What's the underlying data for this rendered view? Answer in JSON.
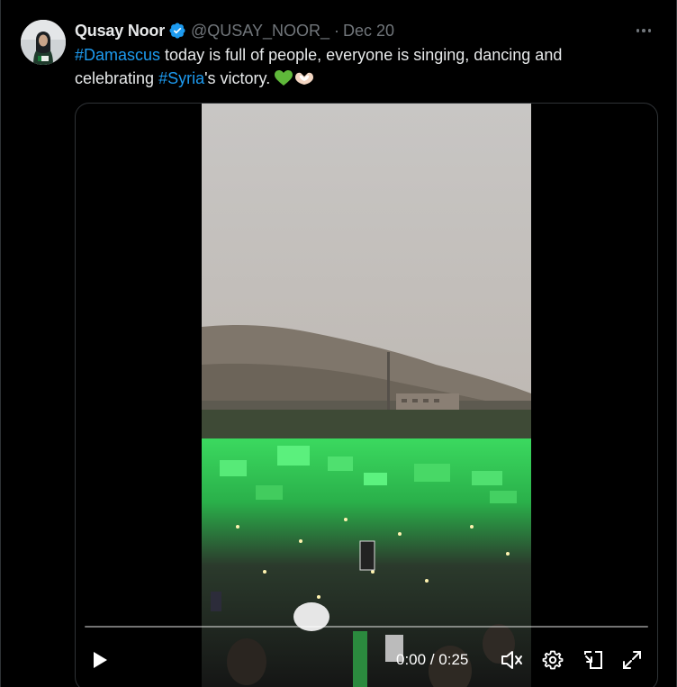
{
  "tweet": {
    "author_name": "Qusay Noor",
    "handle": "@QUSAY_NOOR_",
    "separator": "·",
    "date": "Dec 20",
    "text_parts": {
      "hashtag1": "#Damascus",
      "text1": " today is full of people, everyone is singing, dancing and celebrating ",
      "hashtag2": "#Syria",
      "text2": "'s victory. "
    },
    "emojis": [
      "green-heart",
      "heart-hands"
    ]
  },
  "icons": {
    "verified": "verified-badge-icon",
    "more": "more-options-icon",
    "play": "play-icon",
    "mute": "muted-volume-icon",
    "settings": "settings-gear-icon",
    "pip": "picture-in-picture-icon",
    "fullscreen": "fullscreen-icon"
  },
  "video": {
    "current_time": "0:00",
    "time_separator": " / ",
    "duration": "0:25",
    "progress": 0
  },
  "colors": {
    "accent": "#1d9bf0",
    "background": "#000000",
    "text": "#e7e9ea",
    "muted_text": "#71767b",
    "crowd_green": "#39e66a"
  }
}
